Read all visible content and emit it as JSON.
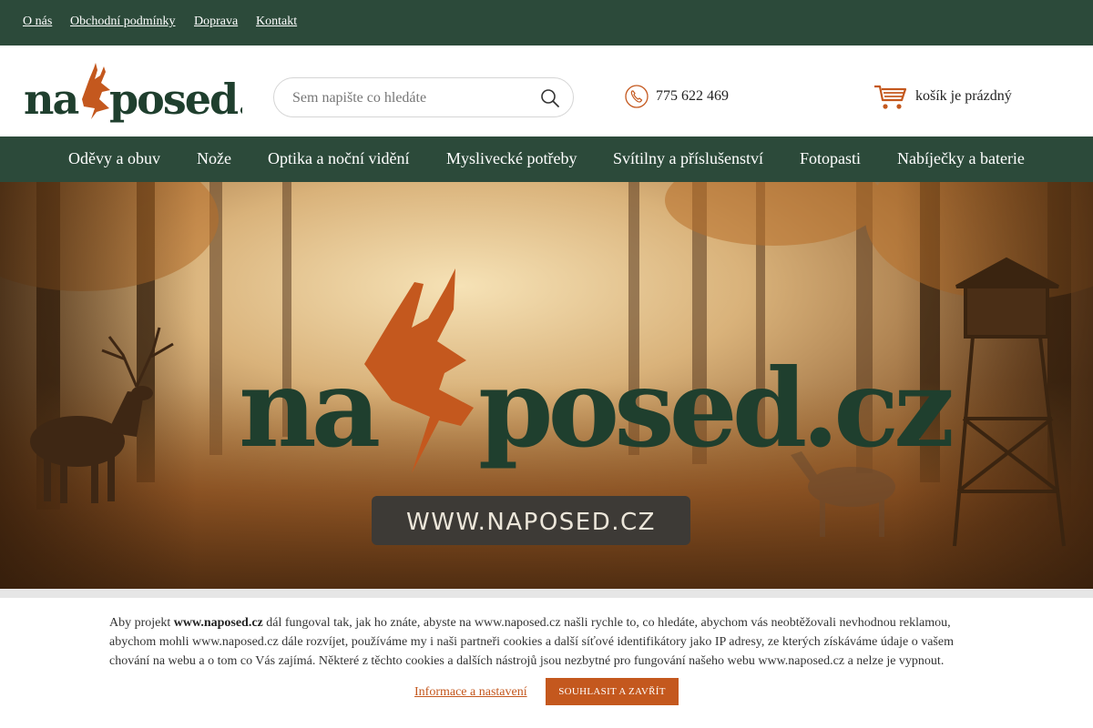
{
  "topbar": {
    "links": [
      "O nás",
      "Obchodní podmínky",
      "Doprava",
      "Kontakt"
    ]
  },
  "header": {
    "logo_text": "naposed.cz",
    "search_placeholder": "Sem napište co hledáte",
    "phone": "775 622 469",
    "cart_label": "košík je prázdný"
  },
  "nav": {
    "items": [
      "Oděvy a obuv",
      "Nože",
      "Optika a noční vidění",
      "Myslivecké potřeby",
      "Svítilny a příslušenství",
      "Fotopasti",
      "Nabíječky a baterie"
    ]
  },
  "hero": {
    "logo_text": "naposed.cz",
    "url_banner": "WWW.NAPOSED.CZ"
  },
  "cookie": {
    "text_before": "Aby projekt ",
    "site_bold": "www.naposed.cz",
    "text_after": " dál fungoval tak, jak ho znáte, abyste na www.naposed.cz našli rychle to, co hledáte, abychom vás neobtěžovali nevhodnou reklamou, abychom mohli www.naposed.cz dále rozvíjet, používáme my i naši partneři cookies a další síťové identifikátory jako IP adresy, ze kterých získáváme údaje o vašem chování na webu a o tom co Vás zajímá. Některé z těchto cookies a dalších nástrojů jsou nezbytné pro fungování našeho webu www.naposed.cz a nelze je vypnout.",
    "info_link": "Informace a nastavení",
    "accept_button": "SOUHLASIT A ZAVŘÍT"
  },
  "colors": {
    "brand_green": "#2c4a3a",
    "brand_orange": "#c4581e"
  }
}
